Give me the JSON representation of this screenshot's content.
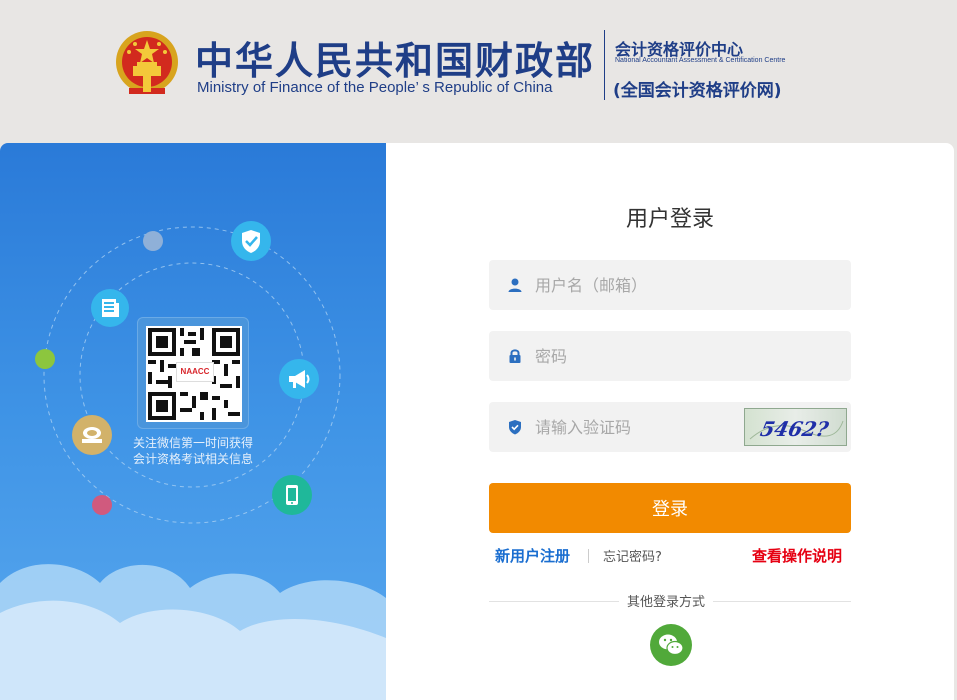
{
  "header": {
    "title_cn": "中华人民共和国财政部",
    "title_en": "Ministry of Finance of the People’ s Republic of China",
    "center_cn": "会计资格评价中心",
    "center_en": "National Accountant Assessment & Certification Centre",
    "center_net": "(全国会计资格评价网)"
  },
  "left": {
    "qr_badge": "NAACC",
    "caption_line1": "关注微信第一时间获得",
    "caption_line2": "会计资格考试相关信息",
    "icons": [
      "shield-icon",
      "news-icon",
      "megaphone-icon",
      "certificate-icon",
      "mobile-icon"
    ]
  },
  "login": {
    "title": "用户登录",
    "username_placeholder": "用户名（邮箱）",
    "password_placeholder": "密码",
    "captcha_placeholder": "请输入验证码",
    "captcha_text": "5462?",
    "submit_label": "登录",
    "register_label": "新用户注册",
    "forgot_label": "忘记密码?",
    "help_label": "查看操作说明",
    "other_methods_label": "其他登录方式"
  },
  "colors": {
    "brand_blue": "#1f3e87",
    "accent_orange": "#f28a00",
    "link_blue": "#1a6ed0",
    "link_red": "#e60012",
    "wechat_green": "#51a93a"
  }
}
